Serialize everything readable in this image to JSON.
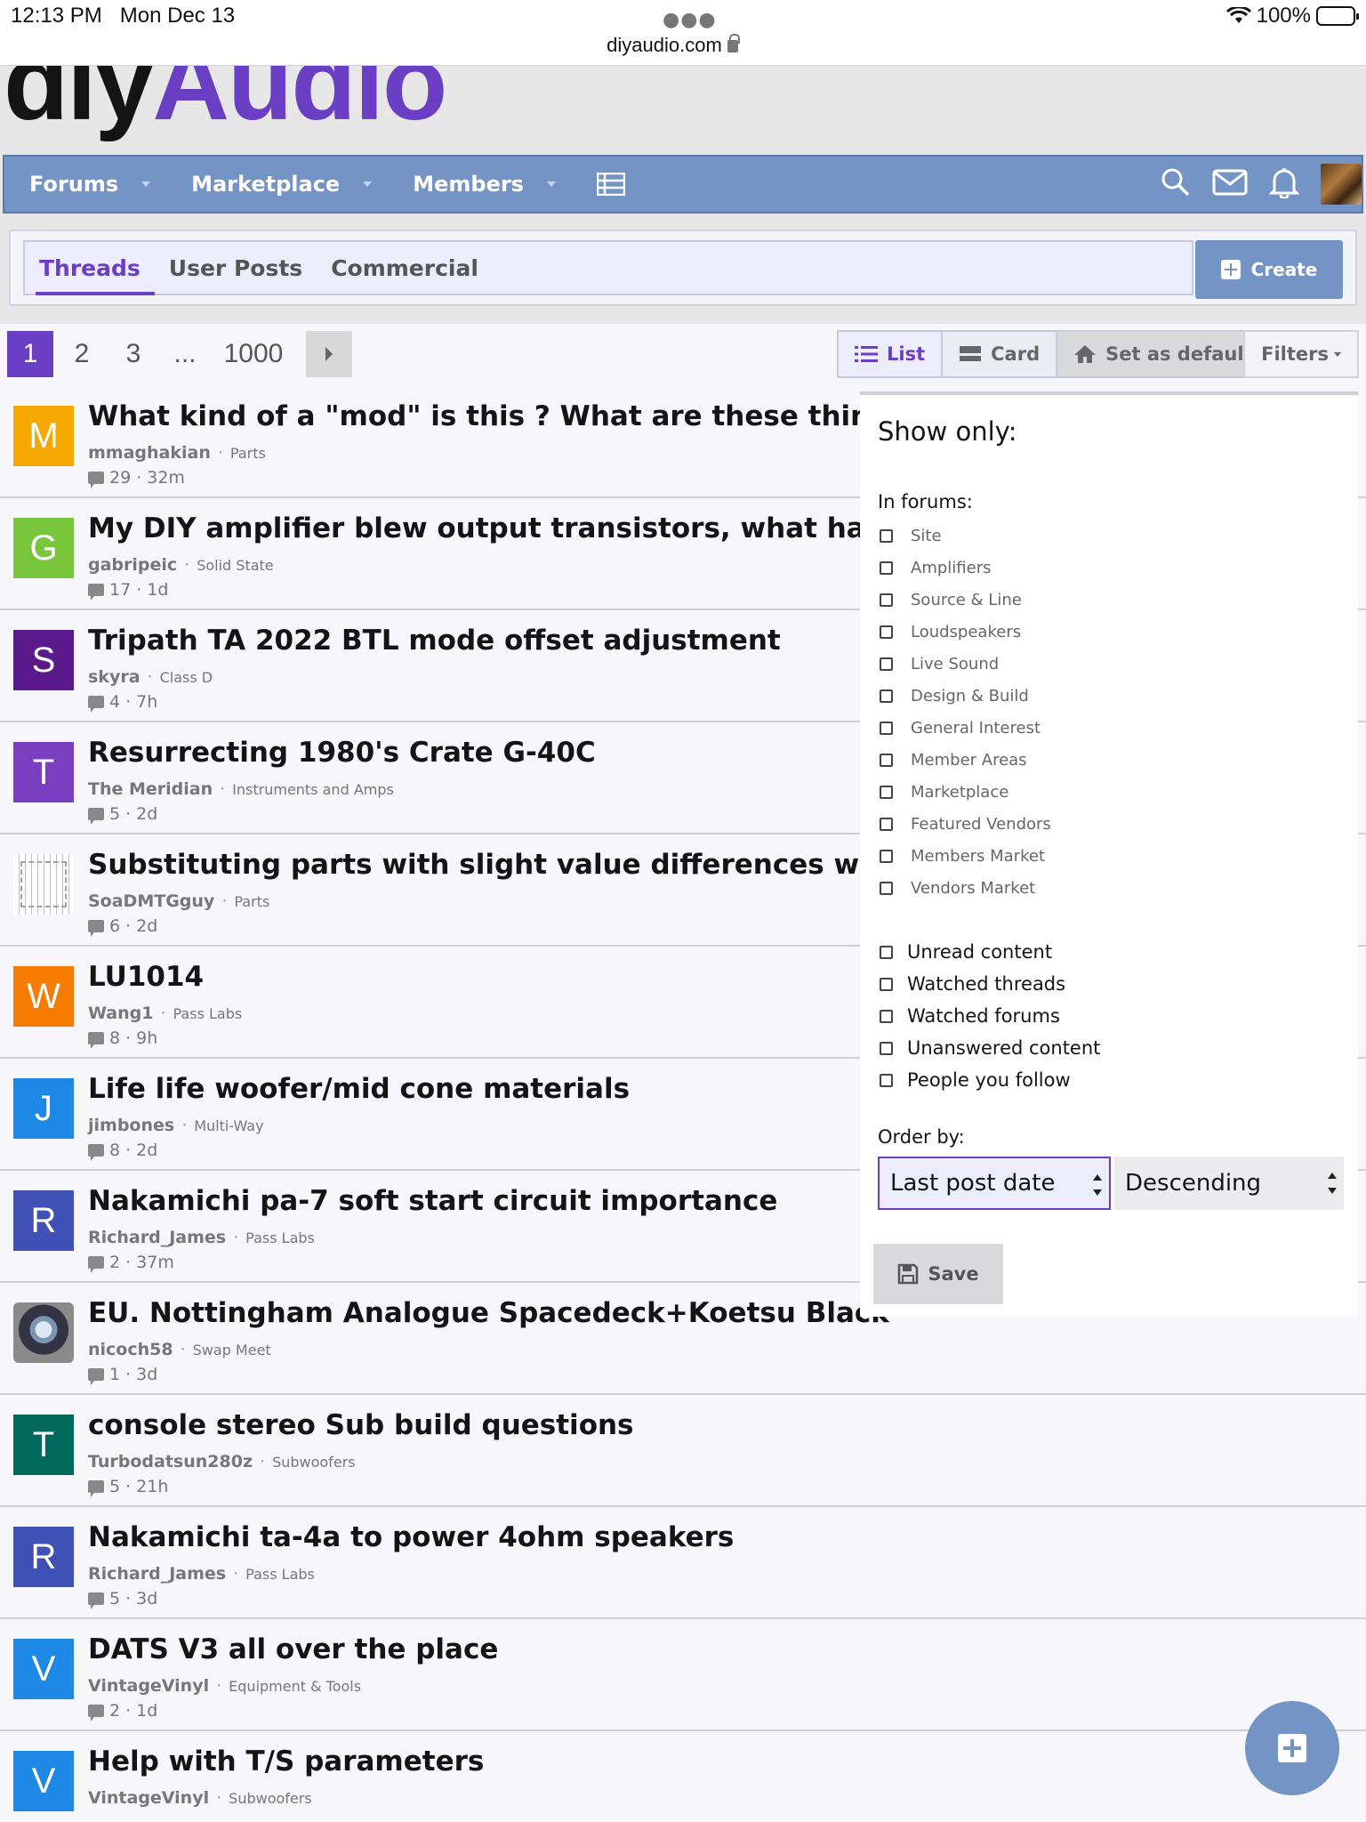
{
  "status_bar": {
    "time": "12:13 PM",
    "date": "Mon Dec 13",
    "url": "diyaudio.com",
    "battery": "100%"
  },
  "logo": {
    "part1": "diy",
    "part2": "Audio"
  },
  "nav": {
    "items": [
      {
        "label": "Forums"
      },
      {
        "label": "Marketplace"
      },
      {
        "label": "Members"
      }
    ]
  },
  "tabs": [
    {
      "label": "Threads"
    },
    {
      "label": "User Posts"
    },
    {
      "label": "Commercial"
    }
  ],
  "create_label": "Create",
  "pager": {
    "pages": [
      "1",
      "2",
      "3",
      "...",
      "1000"
    ]
  },
  "view": {
    "list": "List",
    "card": "Card",
    "set_default": "Set as default",
    "filters": "Filters"
  },
  "threads": [
    {
      "initial": "M",
      "color": "#f5a800",
      "title": "What kind of a \"mod\" is this ? What are these things?",
      "user": "mmaghakian",
      "forum": "Parts",
      "replies": "29",
      "age": "32m"
    },
    {
      "initial": "G",
      "color": "#79c63c",
      "title": "My DIY amplifier blew output transistors, what has gone wrong?",
      "user": "gabripeic",
      "forum": "Solid State",
      "replies": "17",
      "age": "1d"
    },
    {
      "initial": "S",
      "color": "#5b1a8c",
      "title": "Tripath TA 2022 BTL mode offset adjustment",
      "user": "skyra",
      "forum": "Class D",
      "replies": "4",
      "age": "7h"
    },
    {
      "initial": "T",
      "color": "#7a3fc0",
      "title": "Resurrecting 1980's Crate G-40C",
      "user": "The Meridian",
      "forum": "Instruments and Amps",
      "replies": "5",
      "age": "2d"
    },
    {
      "initial": "",
      "color": "#ffffff",
      "title": "Substituting parts with slight value differences with...",
      "user": "SoaDMTGguy",
      "forum": "Parts",
      "replies": "6",
      "age": "2d"
    },
    {
      "initial": "W",
      "color": "#f57c00",
      "title": "LU1014",
      "user": "Wang1",
      "forum": "Pass Labs",
      "replies": "8",
      "age": "9h"
    },
    {
      "initial": "J",
      "color": "#1e88e5",
      "title": "Life life woofer/mid cone materials",
      "user": "jimbones",
      "forum": "Multi-Way",
      "replies": "8",
      "age": "2d"
    },
    {
      "initial": "R",
      "color": "#3f51b5",
      "title": "Nakamichi pa-7 soft start circuit importance",
      "user": "Richard_James",
      "forum": "Pass Labs",
      "replies": "2",
      "age": "37m"
    },
    {
      "initial": "",
      "color": "#888888",
      "title": "EU. Nottingham Analogue Spacedeck+Koetsu Black",
      "user": "nicoch58",
      "forum": "Swap Meet",
      "replies": "1",
      "age": "3d"
    },
    {
      "initial": "T",
      "color": "#00695c",
      "title": "console stereo Sub build questions",
      "user": "Turbodatsun280z",
      "forum": "Subwoofers",
      "replies": "5",
      "age": "21h"
    },
    {
      "initial": "R",
      "color": "#3f51b5",
      "title": "Nakamichi ta-4a to power 4ohm speakers",
      "user": "Richard_James",
      "forum": "Pass Labs",
      "replies": "5",
      "age": "3d"
    },
    {
      "initial": "V",
      "color": "#1e88e5",
      "title": "DATS V3 all over the place",
      "user": "VintageVinyl",
      "forum": "Equipment & Tools",
      "replies": "2",
      "age": "1d"
    },
    {
      "initial": "V",
      "color": "#1e88e5",
      "title": "Help with T/S parameters",
      "user": "VintageVinyl",
      "forum": "Subwoofers",
      "replies": "",
      "age": ""
    }
  ],
  "filter_panel": {
    "title": "Show only:",
    "in_forums_label": "In forums:",
    "forums": [
      "Site",
      "Amplifiers",
      "Source & Line",
      "Loudspeakers",
      "Live Sound",
      "Design & Build",
      "General Interest",
      "Member Areas",
      "Marketplace",
      "Featured Vendors",
      "Members Market",
      "Vendors Market"
    ],
    "options": [
      "Unread content",
      "Watched threads",
      "Watched forums",
      "Unanswered content",
      "People you follow"
    ],
    "order_label": "Order by:",
    "order_field": "Last post date",
    "order_dir": "Descending",
    "save_label": "Save"
  }
}
